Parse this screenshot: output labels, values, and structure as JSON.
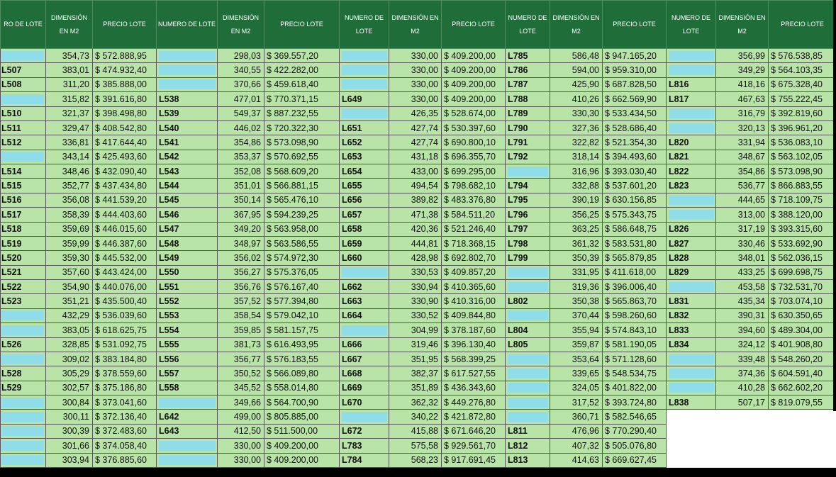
{
  "headers": [
    "RO DE LOTE",
    "DIMENSIÓN EN M2",
    "PRECIO LOTE",
    "NUMERO DE LOTE",
    "DIMENSIÓN EN M2",
    "PRECIO LOTE",
    "NUMERO DE LOTE",
    "DIMENSIÓN EN M2",
    "PRECIO LOTE",
    "NUMERO DE LOTE",
    "DIMENSIÓN EN M2",
    "PRECIO LOTE",
    "NUMERO DE LOTE",
    "DIMENSIÓN EN M2",
    "PRECIO LOTE"
  ],
  "colors": {
    "header": "#1f6e3a",
    "cell": "#b9e4a8",
    "blank_lot": "#8fdde8"
  },
  "rows": [
    [
      "",
      "354,73",
      "$ 572.888,95",
      "",
      "298,03",
      "$  369.557,20",
      "",
      "330,00",
      "$ 409.200,00",
      "L785",
      "586,48",
      "$ 947.165,20",
      "",
      "356,99",
      "$  576.538,85"
    ],
    [
      "L507",
      "383,01",
      "$ 474.932,40",
      "",
      "340,55",
      "$  422.282,00",
      "",
      "330,00",
      "$ 409.200,00",
      "L786",
      "594,00",
      "$ 959.310,00",
      "",
      "349,29",
      "$  564.103,35"
    ],
    [
      "L508",
      "311,20",
      "$ 385.888,00",
      "",
      "370,66",
      "$  459.618,40",
      "",
      "330,00",
      "$ 409.200,00",
      "L787",
      "425,90",
      "$ 687.828,50",
      "L816",
      "418,16",
      "$  675.328,40"
    ],
    [
      "",
      "315,82",
      "$ 391.616,80",
      "L538",
      "477,01",
      "$  770.371,15",
      "L649",
      "330,00",
      "$ 409.200,00",
      "L788",
      "410,26",
      "$ 662.569,90",
      "L817",
      "467,63",
      "$  755.222,45"
    ],
    [
      "L510",
      "321,37",
      "$ 398.498,80",
      "L539",
      "549,37",
      "$  887.232,55",
      "",
      "426,35",
      "$ 528.674,00",
      "L789",
      "330,30",
      "$ 533.434,50",
      "",
      "316,79",
      "$  392.819,60"
    ],
    [
      "L511",
      "329,47",
      "$ 408.542,80",
      "L540",
      "446,02",
      "$  720.322,30",
      "L651",
      "427,74",
      "$ 530.397,60",
      "L790",
      "327,36",
      "$ 528.686,40",
      "",
      "320,13",
      "$  396.961,20"
    ],
    [
      "L512",
      "336,81",
      "$ 417.644,40",
      "L541",
      "354,86",
      "$  573.098,90",
      "L652",
      "427,74",
      "$ 690.800,10",
      "L791",
      "322,82",
      "$ 521.354,30",
      "L820",
      "331,94",
      "$  536.083,10"
    ],
    [
      "",
      "343,14",
      "$ 425.493,60",
      "L542",
      "353,37",
      "$  570.692,55",
      "L653",
      "431,18",
      "$ 696.355,70",
      "L792",
      "318,14",
      "$ 394.493,60",
      "L821",
      "348,67",
      "$  563.102,05"
    ],
    [
      "L514",
      "348,46",
      "$ 432.090,40",
      "L543",
      "352,08",
      "$  568.609,20",
      "L654",
      "433,00",
      "$ 699.295,00",
      "",
      "316,96",
      "$ 393.030,40",
      "L822",
      "354,86",
      "$  573.098,90"
    ],
    [
      "L515",
      "352,77",
      "$ 437.434,80",
      "L544",
      "351,01",
      "$  566.881,15",
      "L655",
      "494,54",
      "$ 798.682,10",
      "L794",
      "332,88",
      "$ 537.601,20",
      "L823",
      "536,77",
      "$  866.883,55"
    ],
    [
      "L516",
      "356,08",
      "$ 441.539,20",
      "L545",
      "350,14",
      "$  565.476,10",
      "L656",
      "389,82",
      "$ 483.376,80",
      "L795",
      "390,19",
      "$ 630.156,85",
      "",
      "444,65",
      "$  718.109,75"
    ],
    [
      "L517",
      "358,39",
      "$ 444.403,60",
      "L546",
      "367,95",
      "$  594.239,25",
      "L657",
      "471,38",
      "$ 584.511,20",
      "L796",
      "356,25",
      "$ 575.343,75",
      "",
      "313,00",
      "$  388.120,00"
    ],
    [
      "L518",
      "359,69",
      "$ 446.015,60",
      "L547",
      "349,20",
      "$  563.958,00",
      "L658",
      "420,36",
      "$ 521.246,40",
      "L797",
      "363,25",
      "$ 586.648,75",
      "L826",
      "317,19",
      "$  393.315,60"
    ],
    [
      "L519",
      "359,99",
      "$ 446.387,60",
      "L548",
      "348,97",
      "$  563.586,55",
      "L659",
      "444,81",
      "$ 718.368,15",
      "L798",
      "361,32",
      "$ 583.531,80",
      "L827",
      "330,46",
      "$  533.692,90"
    ],
    [
      "L520",
      "359,30",
      "$ 445.532,00",
      "L549",
      "356,02",
      "$  574.972,30",
      "L660",
      "428,98",
      "$ 692.802,70",
      "L799",
      "350,39",
      "$ 565.879,85",
      "L828",
      "348,01",
      "$  562.036,15"
    ],
    [
      "L521",
      "357,60",
      "$ 443.424,00",
      "L550",
      "356,27",
      "$  575.376,05",
      "",
      "330,53",
      "$ 409.857,20",
      "",
      "331,95",
      "$ 411.618,00",
      "L829",
      "433,25",
      "$  699.698,75"
    ],
    [
      "L522",
      "354,90",
      "$ 440.076,00",
      "L551",
      "356,76",
      "$  576.167,40",
      "L662",
      "330,94",
      "$ 410.365,60",
      "",
      "319,36",
      "$ 396.006,40",
      "",
      "453,58",
      "$  732.531,70"
    ],
    [
      "L523",
      "351,21",
      "$ 435.500,40",
      "L552",
      "357,52",
      "$  577.394,80",
      "L663",
      "330,90",
      "$ 410.316,00",
      "L802",
      "350,38",
      "$ 565.863,70",
      "L831",
      "435,34",
      "$  703.074,10"
    ],
    [
      "",
      "432,29",
      "$ 536.039,60",
      "L553",
      "358,54",
      "$  579.042,10",
      "L664",
      "330,52",
      "$ 409.844,80",
      "",
      "370,44",
      "$ 598.260,60",
      "L832",
      "390,31",
      "$  630.350,65"
    ],
    [
      "",
      "383,05",
      "$ 618.625,75",
      "L554",
      "359,85",
      "$  581.157,75",
      "",
      "304,99",
      "$ 378.187,60",
      "L804",
      "355,94",
      "$ 574.843,10",
      "L833",
      "394,60",
      "$  489.304,00"
    ],
    [
      "L526",
      "328,85",
      "$ 531.092,75",
      "L555",
      "381,73",
      "$  616.493,95",
      "L666",
      "319,46",
      "$ 396.130,40",
      "L805",
      "359,87",
      "$ 581.190,05",
      "L834",
      "324,12",
      "$  401.908,80"
    ],
    [
      "",
      "309,02",
      "$ 383.184,80",
      "L556",
      "356,77",
      "$  576.183,55",
      "L667",
      "351,95",
      "$ 568.399,25",
      "",
      "353,64",
      "$ 571.128,60",
      "",
      "339,48",
      "$  548.260,20"
    ],
    [
      "L528",
      "305,29",
      "$ 378.559,60",
      "L557",
      "350,52",
      "$  566.089,80",
      "L668",
      "382,37",
      "$ 617.527,55",
      "",
      "339,65",
      "$ 548.534,75",
      "",
      "374,36",
      "$  604.591,40"
    ],
    [
      "L529",
      "302,57",
      "$ 375.186,80",
      "L558",
      "345,52",
      "$  558.014,80",
      "L669",
      "351,89",
      "$ 436.343,60",
      "",
      "324,05",
      "$ 401.822,00",
      "",
      "410,28",
      "$  662.602,20"
    ],
    [
      "",
      "300,84",
      "$ 373.041,60",
      "",
      "349,66",
      "$  564.700,90",
      "L670",
      "362,32",
      "$ 449.276,80",
      "",
      "317,52",
      "$ 393.724,80",
      "L838",
      "507,17",
      "$  819.079,55"
    ],
    [
      "",
      "300,11",
      "$ 372.136,40",
      "L642",
      "499,00",
      "$  805.885,00",
      "",
      "340,22",
      "$ 421.872,80",
      "",
      "360,71",
      "$ 582.546,65",
      null,
      null,
      null
    ],
    [
      "",
      "300,39",
      "$ 372.483,60",
      "L643",
      "412,50",
      "$  511.500,00",
      "L672",
      "415,88",
      "$ 671.646,20",
      "L811",
      "476,96",
      "$ 770.290,40",
      null,
      null,
      null
    ],
    [
      "",
      "301,66",
      "$ 374.058,40",
      "",
      "330,00",
      "$  409.200,00",
      "L783",
      "575,58",
      "$ 929.561,70",
      "L812",
      "407,32",
      "$ 505.076,80",
      null,
      null,
      null
    ],
    [
      "",
      "303,94",
      "$ 376.885,60",
      "",
      "330,00",
      "$  409.200,00",
      "L784",
      "568,23",
      "$ 917.691,45",
      "L813",
      "414,63",
      "$ 669.627,45",
      null,
      null,
      null
    ]
  ]
}
